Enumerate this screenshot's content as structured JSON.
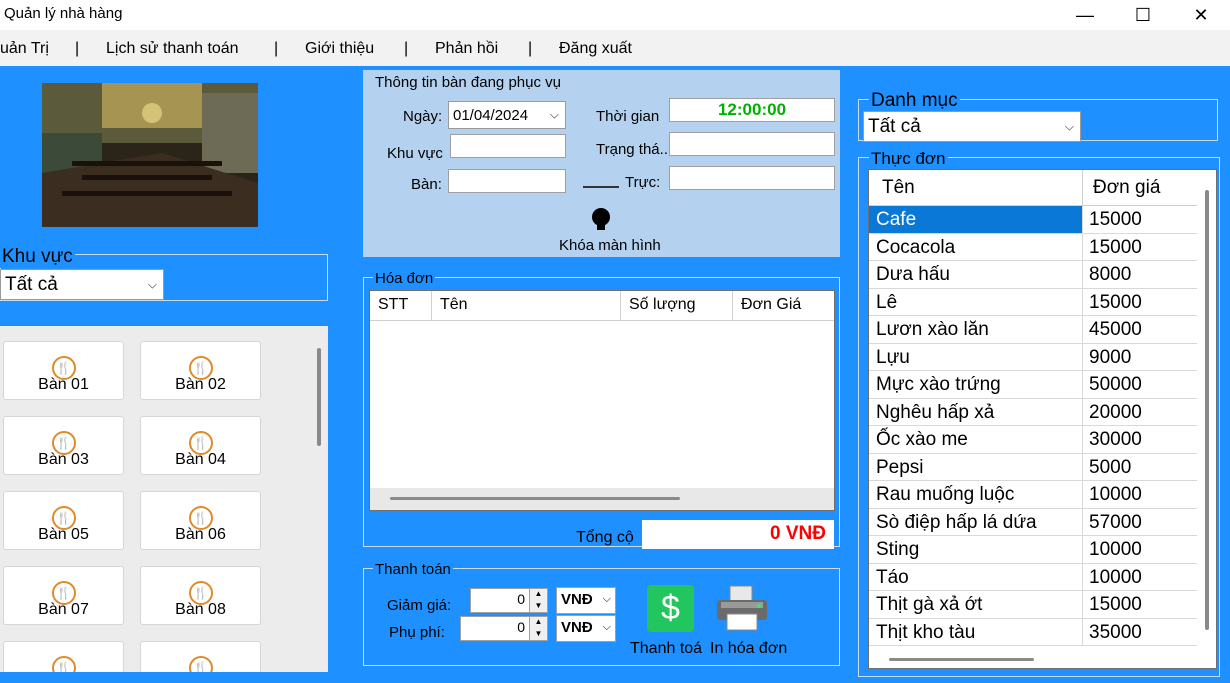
{
  "window": {
    "title": "Quản lý nhà hàng",
    "minimize": "—",
    "maximize": "☐",
    "close": "✕"
  },
  "menu": {
    "items": [
      "uản Trị",
      "Lịch sử thanh toán",
      "Giới thiệu",
      "Phản hồi",
      "Đăng xuất"
    ],
    "separator": "|"
  },
  "khu_vuc": {
    "title": "Khu vực",
    "selected": "Tất cả"
  },
  "tables": [
    "Bàn 01",
    "Bàn 02",
    "Bàn 03",
    "Bàn 04",
    "Bàn 05",
    "Bàn 06",
    "Bàn 07",
    "Bàn 08"
  ],
  "info": {
    "title": "Thông tin bàn đang phục vụ",
    "date_label": "Ngày:",
    "date_value": "01/04/2024",
    "time_label": "Thời gian",
    "time_value": "12:00:00",
    "area_label": "Khu vực",
    "status_label": "Trạng thá...",
    "table_label": "Bàn:",
    "shift_label": "Trực:",
    "lock_label": "Khóa màn hình"
  },
  "bill": {
    "title": "Hóa đơn",
    "columns": [
      "STT",
      "Tên",
      "Số lượng",
      "Đơn Giá"
    ],
    "total_label": "Tổng cộ",
    "total_value": "0 VNĐ"
  },
  "payment": {
    "title": "Thanh toán",
    "discount_label": "Giảm giá:",
    "discount_value": "0",
    "fee_label": "Phụ phí:",
    "fee_value": "0",
    "currency": "VNĐ",
    "pay_label": "Thanh toá",
    "print_label": "In hóa đơn"
  },
  "category": {
    "title": "Danh mục",
    "selected": "Tất cả"
  },
  "food_menu": {
    "title": "Thực đơn",
    "columns": [
      "Tên",
      "Đơn giá"
    ],
    "rows": [
      {
        "name": "Cafe",
        "price": "15000"
      },
      {
        "name": "Cocacola",
        "price": "15000"
      },
      {
        "name": "Dưa hấu",
        "price": "8000"
      },
      {
        "name": "Lê",
        "price": "15000"
      },
      {
        "name": "Lươn xào lăn",
        "price": "45000"
      },
      {
        "name": "Lựu",
        "price": "9000"
      },
      {
        "name": "Mực xào trứng",
        "price": "50000"
      },
      {
        "name": "Nghêu hấp xả",
        "price": "20000"
      },
      {
        "name": "Ốc xào me",
        "price": "30000"
      },
      {
        "name": "Pepsi",
        "price": "5000"
      },
      {
        "name": "Rau muống luộc",
        "price": "10000"
      },
      {
        "name": "Sò điệp hấp lá dứa",
        "price": "57000"
      },
      {
        "name": "Sting",
        "price": "10000"
      },
      {
        "name": "Táo",
        "price": "10000"
      },
      {
        "name": "Thịt gà xả ớt",
        "price": "15000"
      },
      {
        "name": "Thịt kho tàu",
        "price": "35000"
      }
    ]
  },
  "colors": {
    "background": "#1e90ff",
    "selection": "#0a78d7",
    "time": "#00b000",
    "total": "#ff0000",
    "pay_button": "#22c55e"
  }
}
